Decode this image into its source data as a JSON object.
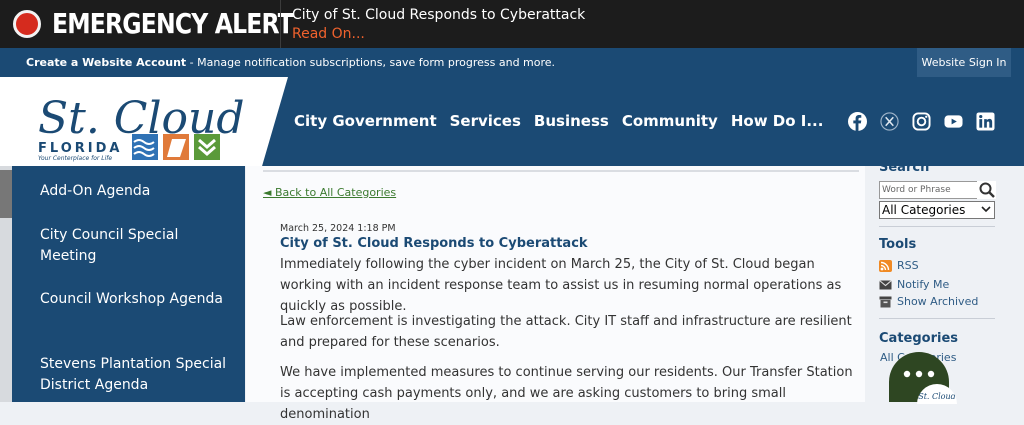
{
  "alert": {
    "label": "EMERGENCY ALERT",
    "title": "City of St. Cloud Responds to Cyberattack",
    "read_on": "Read On..."
  },
  "account_bar": {
    "create_label": "Create a Website Account",
    "description": " - Manage notification subscriptions, save form progress and more.",
    "sign_in": "Website Sign In"
  },
  "logo": {
    "name": "St. Cloud",
    "state": "FLORIDA",
    "tagline": "Your Centerplace for Life"
  },
  "nav": {
    "items": [
      "City Government",
      "Services",
      "Business",
      "Community",
      "How Do I..."
    ]
  },
  "social": [
    "facebook-icon",
    "x-twitter-icon",
    "instagram-icon",
    "youtube-icon",
    "linkedin-icon"
  ],
  "sidebar": {
    "items": [
      "Add-On Agenda",
      "City Council Special Meeting",
      "Council Workshop Agenda",
      "Stevens Plantation Special District Agenda"
    ]
  },
  "article": {
    "back_link": "◄ Back to All Categories",
    "date": "March 25, 2024 1:18 PM",
    "title": "City of St. Cloud Responds to Cyberattack",
    "paragraphs": [
      "Immediately following the cyber incident on March 25, the City of St. Cloud began working with an incident response team to assist us in resuming normal operations as quickly as possible.",
      "Law enforcement is investigating the attack. City IT staff and infrastructure are resilient and prepared for these scenarios.",
      "We have implemented measures to continue serving our residents. Our Transfer Station is accepting cash payments only, and we are asking customers to bring small denomination"
    ]
  },
  "right_rail": {
    "search_label": "Search",
    "search_placeholder": "Word or Phrase",
    "category_select": "All Categories",
    "tools_title": "Tools",
    "tools": [
      "RSS",
      "Notify Me",
      "Show Archived"
    ],
    "categories_title": "Categories",
    "all_categories": "All Categories"
  },
  "colors": {
    "navy": "#1b4a74",
    "alert_red": "#d52b1e",
    "read_on_orange": "#f0622d",
    "link_green": "#3b7a2f"
  }
}
